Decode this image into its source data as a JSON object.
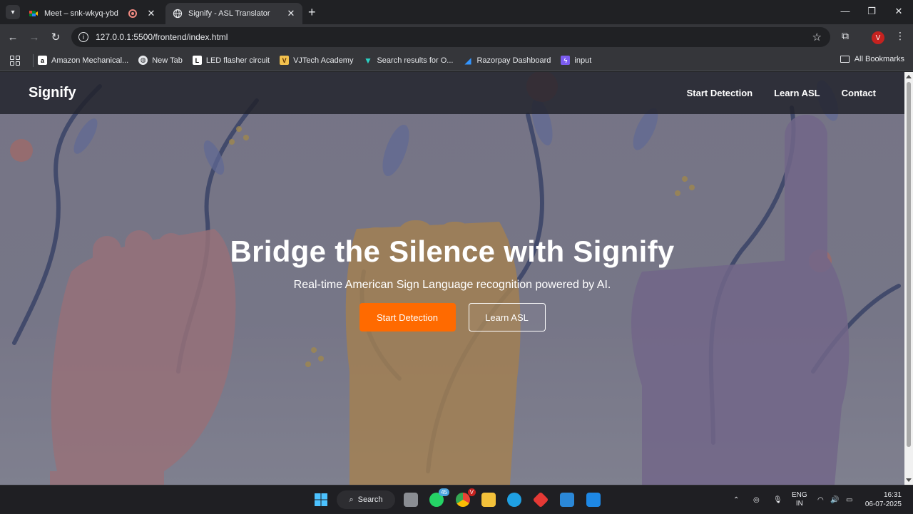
{
  "browser": {
    "tabs": [
      {
        "title": "Meet – snk-wkyq-ybd",
        "active": false
      },
      {
        "title": "Signify - ASL Translator",
        "active": true
      }
    ],
    "url": "127.0.0.1:5500/frontend/index.html",
    "profile_initial": "V",
    "bookmarks": [
      {
        "label": "Amazon Mechanical...",
        "icon": "amazon-icon"
      },
      {
        "label": "New Tab",
        "icon": "globe-icon"
      },
      {
        "label": "LED flasher circuit",
        "icon": "letter-l-icon"
      },
      {
        "label": "VJTech Academy",
        "icon": "vjtech-icon"
      },
      {
        "label": "Search results for O...",
        "icon": "v-logo-icon"
      },
      {
        "label": "Razorpay Dashboard",
        "icon": "razorpay-icon"
      },
      {
        "label": "input",
        "icon": "bolt-icon"
      }
    ],
    "all_bookmarks_label": "All Bookmarks"
  },
  "site": {
    "logo": "Signify",
    "nav": [
      "Start Detection",
      "Learn ASL",
      "Contact"
    ],
    "hero": {
      "title": "Bridge the Silence with Signify",
      "subtitle": "Real-time American Sign Language recognition powered by AI.",
      "primary_button": "Start Detection",
      "secondary_button": "Learn ASL"
    },
    "colors": {
      "accent": "#ff6a00",
      "nav_bg": "#20212a"
    }
  },
  "taskbar": {
    "search_label": "Search",
    "whatsapp_badge": "45",
    "chrome_badge": "V",
    "language": "ENG",
    "region": "IN",
    "time": "16:31",
    "date": "06-07-2025"
  }
}
